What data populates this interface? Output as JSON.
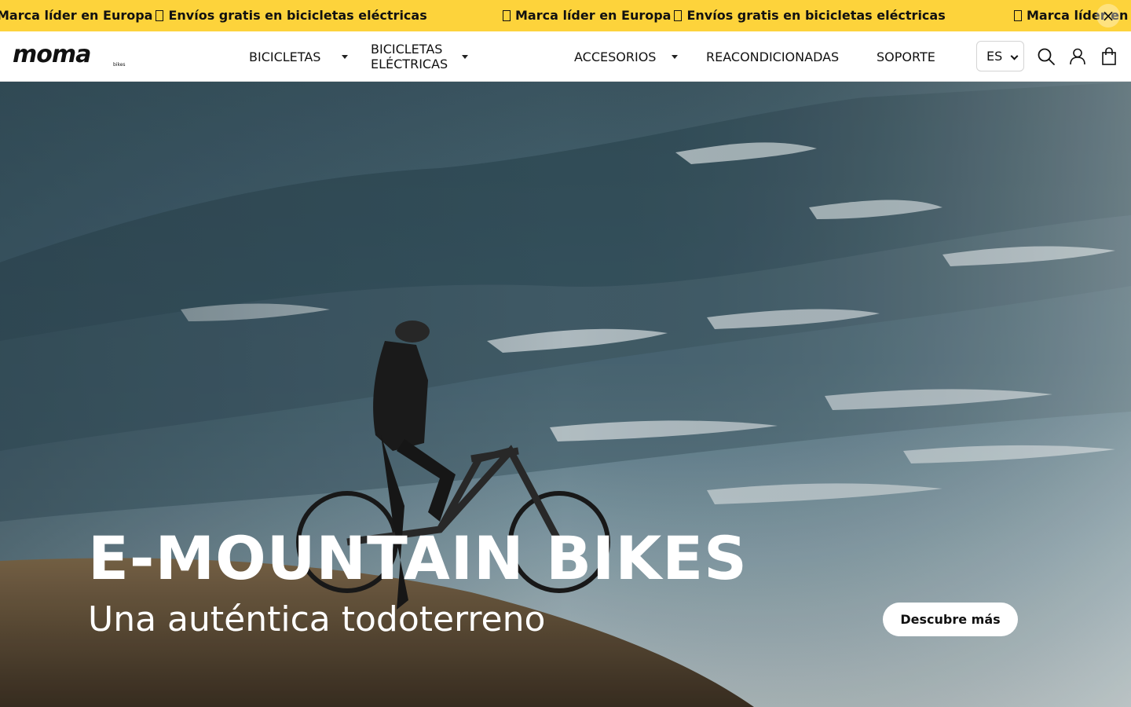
{
  "announcement": {
    "messages": [
      "Marca líder en Europa",
      "Envíos gratis en bicicletas eléctricas",
      "Marca líder en Europa",
      "Envíos gratis en bicicletas eléctricas",
      "Marca líder en"
    ],
    "close_label": "×",
    "background_color": "#fdd33b"
  },
  "header": {
    "logo_text": "moma",
    "logo_sub": "bikes",
    "nav": [
      {
        "label": "BICICLETAS",
        "has_dropdown": true
      },
      {
        "label": "BICICLETAS ELÉCTRICAS",
        "has_dropdown": true
      },
      {
        "label": "ACCESORIOS",
        "has_dropdown": true
      },
      {
        "label": "REACONDICIONADAS",
        "has_dropdown": false
      },
      {
        "label": "SOPORTE",
        "has_dropdown": false
      }
    ],
    "language": {
      "selected": "ES"
    },
    "icons": [
      "search-icon",
      "user-icon",
      "shopping-bag-icon"
    ]
  },
  "hero": {
    "title": "E-MOUNTAIN BIKES",
    "subtitle": "Una auténtica todoterreno",
    "cta_label": "Descubre más"
  }
}
